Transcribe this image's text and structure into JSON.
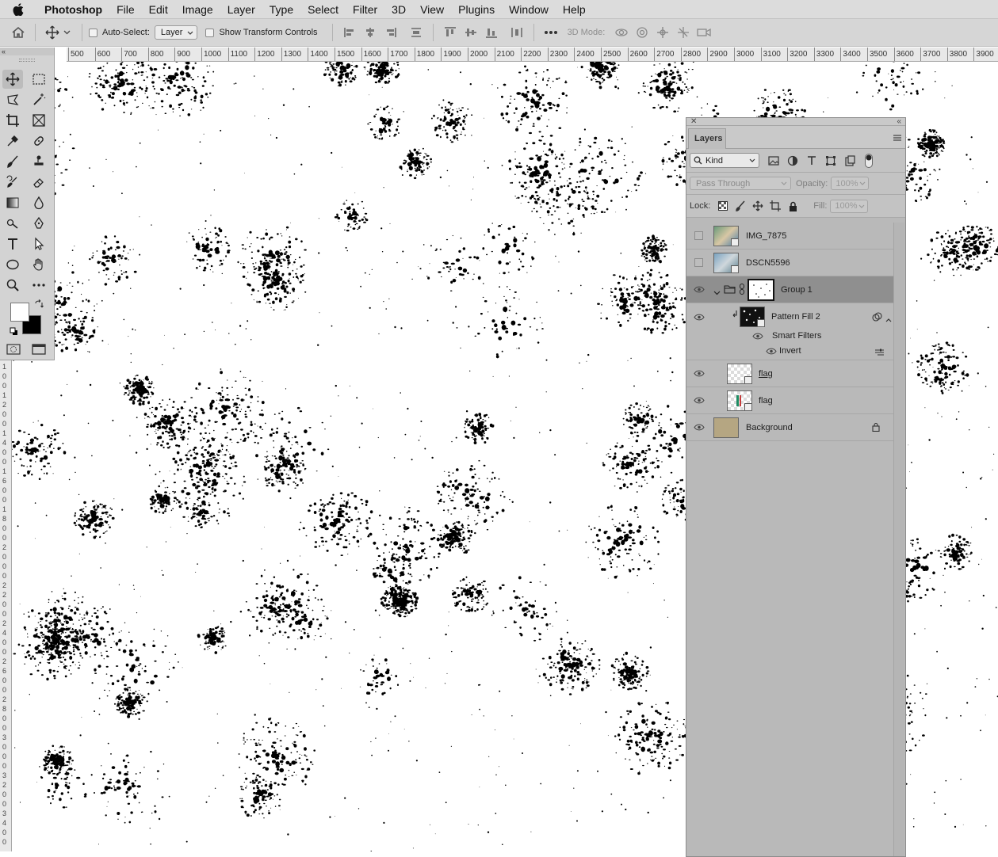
{
  "menubar": {
    "app_name": "Photoshop",
    "items": [
      "File",
      "Edit",
      "Image",
      "Layer",
      "Type",
      "Select",
      "Filter",
      "3D",
      "View",
      "Plugins",
      "Window",
      "Help"
    ]
  },
  "options_bar": {
    "auto_select_label": "Auto-Select:",
    "auto_select_value": "Layer",
    "show_transform_label": "Show Transform Controls",
    "three_d_mode_label": "3D Mode:"
  },
  "ruler": {
    "h_labels": [
      "500",
      "600",
      "700",
      "800",
      "900",
      "1000",
      "1100",
      "1200",
      "1300",
      "1400",
      "1500",
      "1600",
      "1700",
      "1800",
      "1900",
      "2000",
      "2100",
      "2200",
      "2300",
      "2400",
      "2500",
      "2600",
      "2700",
      "2800",
      "2900",
      "3000",
      "3100",
      "3200",
      "3300",
      "3400",
      "3500",
      "3600",
      "3700",
      "3800",
      "3900"
    ],
    "v_digits": [
      "1",
      "0",
      "0",
      "1",
      "2",
      "0",
      "0",
      "1",
      "4",
      "0",
      "0",
      "1",
      "6",
      "0",
      "0",
      "1",
      "8",
      "0",
      "0",
      "2",
      "0",
      "0",
      "0",
      "2",
      "2",
      "0",
      "0",
      "2",
      "4",
      "0",
      "0",
      "2",
      "6",
      "0",
      "0",
      "2",
      "8",
      "0",
      "0",
      "3",
      "0",
      "0",
      "0",
      "3",
      "2",
      "0",
      "0",
      "3",
      "4",
      "0",
      "0"
    ]
  },
  "tools_panel": {
    "collapse_glyph": "«",
    "tools": [
      {
        "name": "move-tool",
        "icon": "move-icon",
        "active": true
      },
      {
        "name": "marquee-tool",
        "icon": "marquee-icon"
      },
      {
        "name": "lasso-tool",
        "icon": "lasso-icon"
      },
      {
        "name": "magic-wand-tool",
        "icon": "magic-wand-icon"
      },
      {
        "name": "crop-tool",
        "icon": "crop-icon"
      },
      {
        "name": "frame-tool",
        "icon": "frame-icon"
      },
      {
        "name": "eyedropper-tool",
        "icon": "eyedropper-icon"
      },
      {
        "name": "healing-tool",
        "icon": "bandage-icon"
      },
      {
        "name": "brush-tool",
        "icon": "brush-icon"
      },
      {
        "name": "stamp-tool",
        "icon": "stamp-icon"
      },
      {
        "name": "history-brush-tool",
        "icon": "history-brush-icon"
      },
      {
        "name": "eraser-tool",
        "icon": "eraser-icon"
      },
      {
        "name": "gradient-tool",
        "icon": "gradient-icon"
      },
      {
        "name": "blur-tool",
        "icon": "drop-icon"
      },
      {
        "name": "dodge-tool",
        "icon": "dodge-icon"
      },
      {
        "name": "pen-tool",
        "icon": "pen-icon"
      },
      {
        "name": "type-tool",
        "icon": "type-icon"
      },
      {
        "name": "path-select-tool",
        "icon": "arrow-icon"
      },
      {
        "name": "shape-tool",
        "icon": "ellipse-icon"
      },
      {
        "name": "hand-tool",
        "icon": "hand-icon"
      },
      {
        "name": "zoom-tool",
        "icon": "zoom-icon"
      },
      {
        "name": "more-tools",
        "icon": "more-icon"
      }
    ],
    "foreground_color": "#ffffff",
    "background_color": "#000000"
  },
  "layers_panel": {
    "tab_label": "Layers",
    "kind_label": "Kind",
    "blend_mode": "Pass Through",
    "opacity_label": "Opacity:",
    "opacity_value": "100%",
    "lock_label": "Lock:",
    "fill_label": "Fill:",
    "fill_value": "100%",
    "layers": [
      {
        "name": "IMG_7875",
        "visible": false
      },
      {
        "name": "DSCN5596",
        "visible": false
      },
      {
        "name": "Group 1",
        "visible": true,
        "selected": true
      },
      {
        "name": "Pattern Fill 2",
        "visible": true
      },
      {
        "name": "Smart Filters",
        "visible": true
      },
      {
        "name": "Invert",
        "visible": true
      },
      {
        "name": "flag",
        "visible": true,
        "underlined": true
      },
      {
        "name": "flag",
        "visible": true
      },
      {
        "name": "Background",
        "visible": true,
        "locked": true
      }
    ],
    "background_swatch": "#b5a682"
  }
}
